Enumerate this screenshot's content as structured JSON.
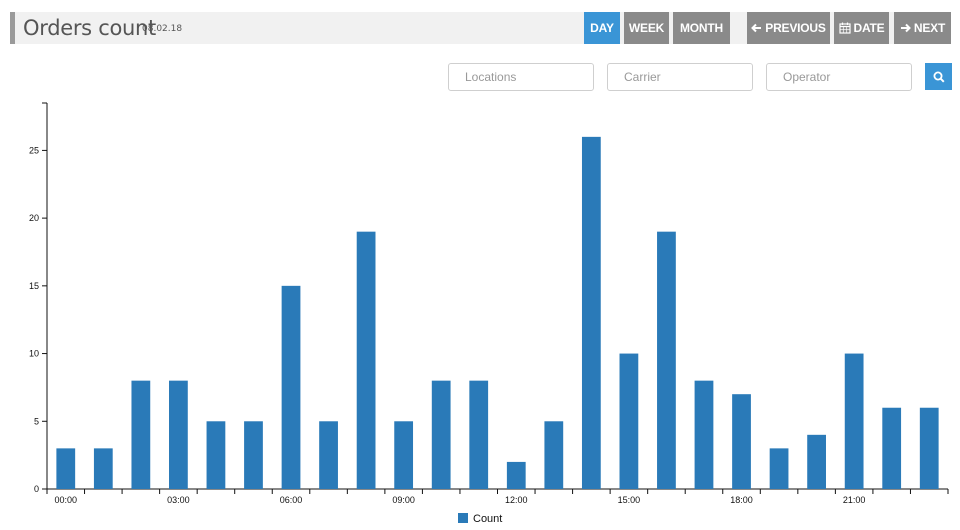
{
  "header": {
    "title": "Orders count",
    "date": "08.02.18",
    "buttons": {
      "day": "DAY",
      "week": "WEEK",
      "month": "MONTH",
      "previous": "PREVIOUS",
      "date": "DATE",
      "next": "NEXT"
    },
    "active_period": "day"
  },
  "filters": {
    "locations_placeholder": "Locations",
    "carrier_placeholder": "Carrier",
    "operator_placeholder": "Operator"
  },
  "colors": {
    "bar": "#2a7ab8",
    "accent": "#3a95d6",
    "button": "#8a8a8a"
  },
  "chart_data": {
    "type": "bar",
    "x_tick_labels": [
      "00:00",
      "03:00",
      "06:00",
      "09:00",
      "12:00",
      "15:00",
      "18:00",
      "21:00"
    ],
    "categories": [
      "00:00",
      "01:00",
      "02:00",
      "03:00",
      "04:00",
      "05:00",
      "06:00",
      "07:00",
      "08:00",
      "09:00",
      "10:00",
      "11:00",
      "12:00",
      "13:00",
      "14:00",
      "15:00",
      "16:00",
      "17:00",
      "18:00",
      "19:00",
      "20:00",
      "21:00",
      "22:00",
      "23:00"
    ],
    "series": [
      {
        "name": "Count",
        "values": [
          3,
          3,
          8,
          8,
          5,
          5,
          15,
          5,
          19,
          5,
          8,
          8,
          2,
          5,
          26,
          10,
          19,
          8,
          7,
          3,
          4,
          10,
          6,
          6
        ]
      }
    ],
    "y_ticks": [
      "0",
      "5",
      "10",
      "15",
      "20",
      "25"
    ],
    "ylim": [
      0,
      28.5
    ],
    "legend": "bottom-center",
    "grid": false
  }
}
